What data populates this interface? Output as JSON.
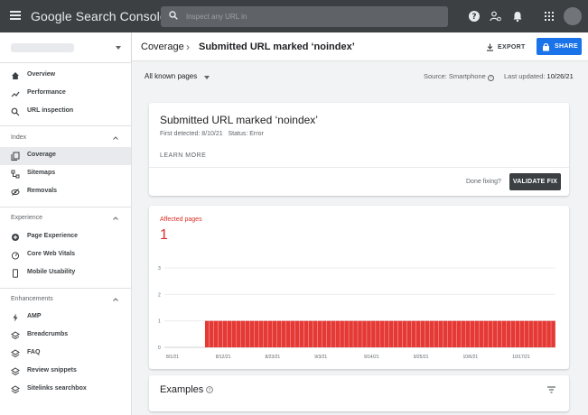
{
  "topbar": {
    "app_title": "Google Search Console",
    "search_placeholder": "Inspect any URL in"
  },
  "sidebar": {
    "items": [
      {
        "label": "Overview",
        "icon": "home-icon"
      },
      {
        "label": "Performance",
        "icon": "trend-icon"
      },
      {
        "label": "URL inspection",
        "icon": "search-icon"
      }
    ],
    "sections": [
      {
        "title": "Index",
        "items": [
          {
            "label": "Coverage",
            "icon": "copy-icon",
            "active": true
          },
          {
            "label": "Sitemaps",
            "icon": "sitemap-icon"
          },
          {
            "label": "Removals",
            "icon": "eye-off-icon"
          }
        ]
      },
      {
        "title": "Experience",
        "items": [
          {
            "label": "Page Experience",
            "icon": "plus-circle-icon"
          },
          {
            "label": "Core Web Vitals",
            "icon": "gauge-icon"
          },
          {
            "label": "Mobile Usability",
            "icon": "phone-icon"
          }
        ]
      },
      {
        "title": "Enhancements",
        "items": [
          {
            "label": "AMP",
            "icon": "bolt-icon"
          },
          {
            "label": "Breadcrumbs",
            "icon": "layers-icon"
          },
          {
            "label": "FAQ",
            "icon": "layers-icon"
          },
          {
            "label": "Review snippets",
            "icon": "layers-icon"
          },
          {
            "label": "Sitelinks searchbox",
            "icon": "layers-icon"
          }
        ]
      }
    ]
  },
  "header": {
    "breadcrumb_root": "Coverage",
    "breadcrumb_sep": "›",
    "breadcrumb_current": "Submitted URL marked ‘noindex’",
    "export_label": "EXPORT",
    "share_label": "SHARE"
  },
  "main": {
    "filter_label": "All known pages",
    "source_text": "Source: Smartphone",
    "updated_prefix": "Last updated: ",
    "updated_date": "10/26/21",
    "issue": {
      "title": "Submitted URL marked ‘noindex’",
      "first_detected": "First detected: 8/10/21",
      "status": "Status: Error",
      "learn_more": "LEARN MORE",
      "done_fixing": "Done fixing?",
      "validate_label": "VALIDATE FIX"
    },
    "affected": {
      "label": "Affected pages",
      "value": "1"
    },
    "examples_title": "Examples"
  },
  "colors": {
    "topbar": "#3c4043",
    "accent": "#1a73e8",
    "error": "#d93025",
    "bar": "#e53935"
  },
  "chart_data": {
    "type": "bar",
    "title": "",
    "xlabel": "",
    "ylabel": "",
    "ylim": [
      0,
      3
    ],
    "yticks": [
      0,
      1,
      2,
      3
    ],
    "xticks": [
      "8/1/21",
      "8/12/21",
      "8/23/21",
      "9/3/21",
      "9/14/21",
      "9/25/21",
      "10/6/21",
      "10/17/21"
    ],
    "x_start": "8/1/21",
    "x_end": "10/26/21",
    "series": [
      {
        "start": "8/10/21",
        "end": "10/26/21",
        "value": 1
      }
    ],
    "grid": true
  }
}
